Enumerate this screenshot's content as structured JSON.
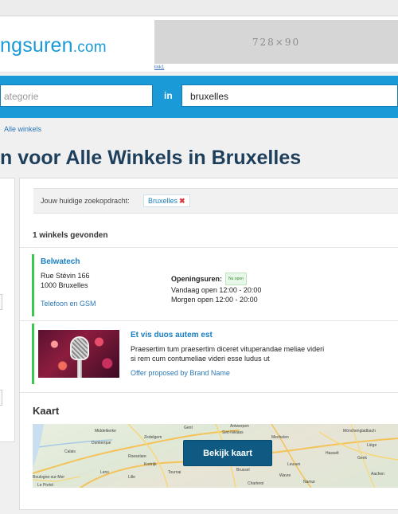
{
  "header": {
    "logo_part1": "ngsuren",
    "logo_part2": ".com",
    "ad_label": "728×90",
    "ad_link": "link1"
  },
  "search": {
    "category_placeholder": "ategorie",
    "in_label": "in",
    "location_value": "bruxelles"
  },
  "breadcrumb": {
    "current": "Alle winkels"
  },
  "page_title": "n voor Alle Winkels in Bruxelles",
  "query": {
    "label": "Jouw huidige zoekopdracht:",
    "tag": "Bruxelles",
    "tag_remove": "✖"
  },
  "results_count": "1 winkels gevonden",
  "store": {
    "name": "Belwatech",
    "street": "Rue Stévin 166",
    "city": "1000 Bruxelles",
    "category": "Telefoon en GSM",
    "hours_label": "Openingsuren:",
    "open_badge": "Nu open",
    "today": "Vandaag open 12:00 - 20:00",
    "tomorrow": "Morgen open 12:00 - 20:00"
  },
  "promo": {
    "title": "Et vis duos autem est",
    "line1": "Praesertim tum praesertim diceret vituperandae meliae videri",
    "line2": "si rem cum contumeliae videri esse ludus ut",
    "link": "Offer proposed by Brand Name"
  },
  "map": {
    "heading": "Kaart",
    "button": "Bekijk kaart",
    "labels": [
      "Middelkerke",
      "Antwerpen",
      "Sint-Niklaas",
      "Zedelgem",
      "Dunkerque",
      "Roeselare",
      "Brussel",
      "Wavre",
      "Calais",
      "Kortrijk",
      "Lille",
      "Tournai",
      "Boulogne-sur-Mer",
      "Lens",
      "Charleroi",
      "Namur",
      "Mönchengladbach",
      "Aachen",
      "Hasselt",
      "Genk",
      "Le Portel",
      "Gent",
      "Mechelen",
      "Leuven",
      "Liège"
    ]
  },
  "colors": {
    "brand_blue": "#1a9ad6",
    "title_navy": "#1d3f5c",
    "accent_green": "#3ec74f",
    "link_blue": "#1a7fc1",
    "map_button": "#0e5a82"
  }
}
